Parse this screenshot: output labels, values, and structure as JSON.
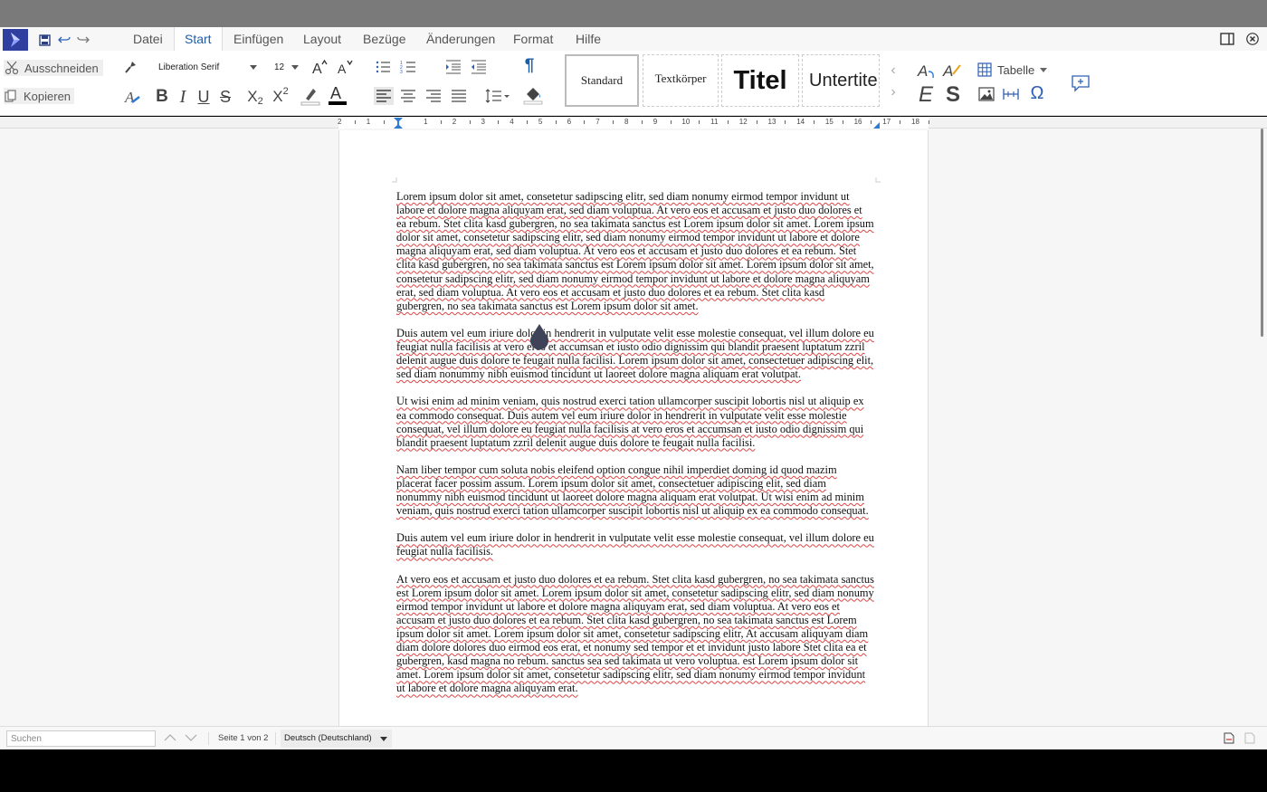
{
  "menubar": {
    "items": [
      {
        "label": "Datei"
      },
      {
        "label": "Start",
        "active": true
      },
      {
        "label": "Einfügen"
      },
      {
        "label": "Layout"
      },
      {
        "label": "Bezüge"
      },
      {
        "label": "Änderungen"
      },
      {
        "label": "Format"
      },
      {
        "label": "Hilfe"
      }
    ]
  },
  "ribbon": {
    "cut_label": "Ausschneiden",
    "copy_label": "Kopieren",
    "font_name": "Liberation Serif",
    "font_size": "12",
    "styles": [
      {
        "label": "Standard"
      },
      {
        "label": "Textkörper"
      },
      {
        "label": "Titel"
      },
      {
        "label": "Untertitel"
      }
    ],
    "table_label": "Tabelle"
  },
  "ruler": {
    "numbers": [
      "2",
      "1",
      "1",
      "2",
      "3",
      "4",
      "5",
      "6",
      "7",
      "8",
      "9",
      "10",
      "11",
      "12",
      "13",
      "14",
      "15",
      "16",
      "17",
      "18"
    ]
  },
  "document": {
    "paragraphs": [
      "Lorem ipsum dolor sit amet, consetetur sadipscing elitr, sed diam nonumy eirmod tempor invidunt ut labore et dolore magna aliquyam erat, sed diam voluptua. At vero eos et accusam et justo duo dolores et ea rebum. Stet clita kasd gubergren, no sea takimata sanctus est Lorem ipsum dolor sit amet. Lorem ipsum dolor sit amet, consetetur sadipscing elitr, sed diam nonumy eirmod tempor invidunt ut labore et dolore magna aliquyam erat, sed diam voluptua. At vero eos et accusam et justo duo dolores et ea rebum. Stet clita kasd gubergren, no sea takimata sanctus est Lorem ipsum dolor sit amet. Lorem ipsum dolor sit amet, consetetur sadipscing elitr, sed diam nonumy eirmod tempor invidunt ut labore et dolore magna aliquyam erat, sed diam voluptua. At vero eos et accusam et justo duo dolores et ea rebum. Stet clita kasd gubergren, no sea takimata sanctus est Lorem ipsum dolor sit amet.",
      "Duis autem vel eum iriure dolor in hendrerit in vulputate velit esse molestie consequat, vel illum dolore eu feugiat nulla facilisis at vero eros et accumsan et iusto odio dignissim qui blandit praesent luptatum zzril delenit augue duis dolore te feugait nulla facilisi. Lorem ipsum dolor sit amet, consectetuer adipiscing elit, sed diam nonummy nibh euismod tincidunt ut laoreet dolore magna aliquam erat volutpat.",
      "Ut wisi enim ad minim veniam, quis nostrud exerci tation ullamcorper suscipit lobortis nisl ut aliquip ex ea commodo consequat. Duis autem vel eum iriure dolor in hendrerit in vulputate velit esse molestie consequat, vel illum dolore eu feugiat nulla facilisis at vero eros et accumsan et iusto odio dignissim qui blandit praesent luptatum zzril delenit augue duis dolore te feugait nulla facilisi.",
      "Nam liber tempor cum soluta nobis eleifend option congue nihil imperdiet doming id quod mazim placerat facer possim assum. Lorem ipsum dolor sit amet, consectetuer adipiscing elit, sed diam nonummy nibh euismod tincidunt ut laoreet dolore magna aliquam erat volutpat. Ut wisi enim ad minim veniam, quis nostrud exerci tation ullamcorper suscipit lobortis nisl ut aliquip ex ea commodo consequat.",
      "Duis autem vel eum iriure dolor in hendrerit in vulputate velit esse molestie consequat, vel illum dolore eu feugiat nulla facilisis.",
      "At vero eos et accusam et justo duo dolores et ea rebum. Stet clita kasd gubergren, no sea takimata sanctus est Lorem ipsum dolor sit amet. Lorem ipsum dolor sit amet, consetetur sadipscing elitr, sed diam nonumy eirmod tempor invidunt ut labore et dolore magna aliquyam erat, sed diam voluptua. At vero eos et accusam et justo duo dolores et ea rebum. Stet clita kasd gubergren, no sea takimata sanctus est Lorem ipsum dolor sit amet. Lorem ipsum dolor sit amet, consetetur sadipscing elitr, At accusam aliquyam diam diam dolore dolores duo eirmod eos erat, et nonumy sed tempor et et invidunt justo labore Stet clita ea et gubergren, kasd magna no rebum. sanctus sea sed takimata ut vero voluptua. est Lorem ipsum dolor sit amet. Lorem ipsum dolor sit amet, consetetur sadipscing elitr, sed diam nonumy eirmod tempor invidunt ut labore et dolore magna aliquyam erat."
    ]
  },
  "statusbar": {
    "search_placeholder": "Suchen",
    "page_info": "Seite 1 von 2",
    "language": "Deutsch (Deutschland)"
  },
  "colors": {
    "accent": "#1d5ea8",
    "logo": "#2e3fa0",
    "spellcheck": "#dd4444"
  }
}
